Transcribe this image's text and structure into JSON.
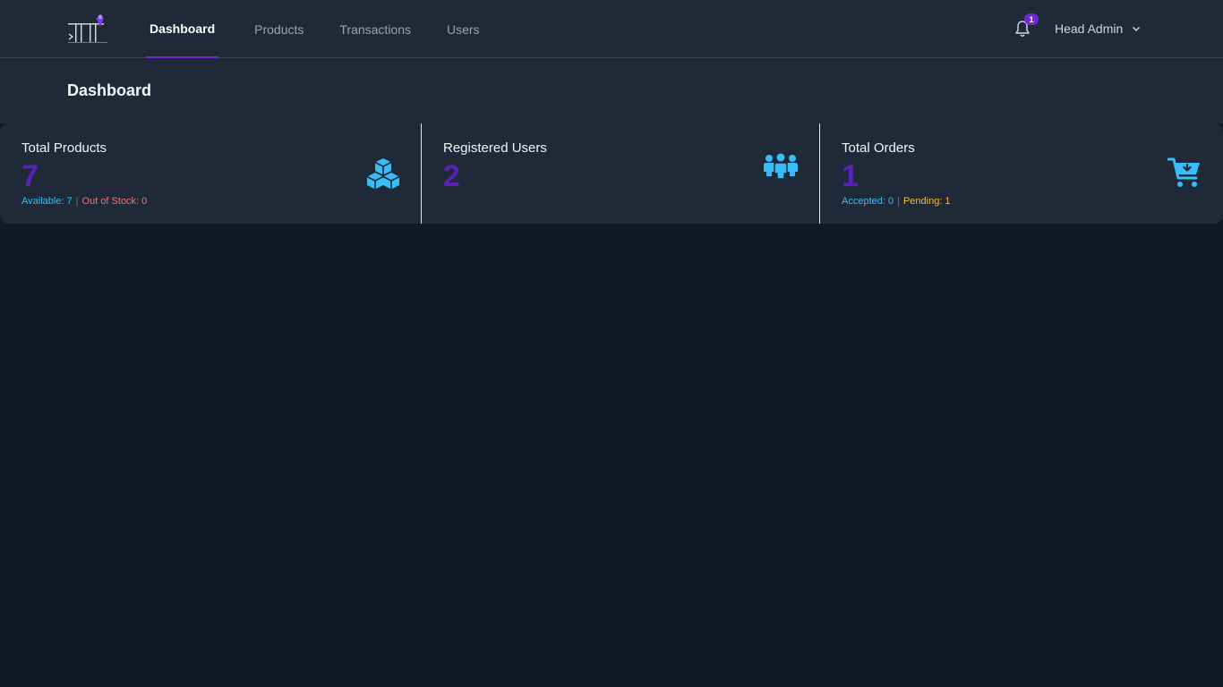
{
  "nav": {
    "tabs": [
      {
        "label": "Dashboard",
        "active": true
      },
      {
        "label": "Products",
        "active": false
      },
      {
        "label": "Transactions",
        "active": false
      },
      {
        "label": "Users",
        "active": false
      }
    ],
    "notification_count": "1",
    "user_name": "Head Admin"
  },
  "page": {
    "title": "Dashboard"
  },
  "stats": {
    "products": {
      "label": "Total Products",
      "value": "7",
      "available_text": "Available: 7",
      "separator": "|",
      "out_of_stock_text": "Out of Stock: 0",
      "icon": "cubes-icon"
    },
    "users": {
      "label": "Registered Users",
      "value": "2",
      "icon": "users-group-icon"
    },
    "orders": {
      "label": "Total Orders",
      "value": "1",
      "accepted_text": "Accepted: 0",
      "separator": "|",
      "pending_text": "Pending: 1",
      "icon": "cart-download-icon"
    }
  },
  "colors": {
    "background": "#111827",
    "panel": "#1f2937",
    "accent": "#6d28d9",
    "icon_blue": "#38bdf8",
    "value_purple": "#5b21b6",
    "danger": "#f87171",
    "warning": "#fbbf24"
  }
}
